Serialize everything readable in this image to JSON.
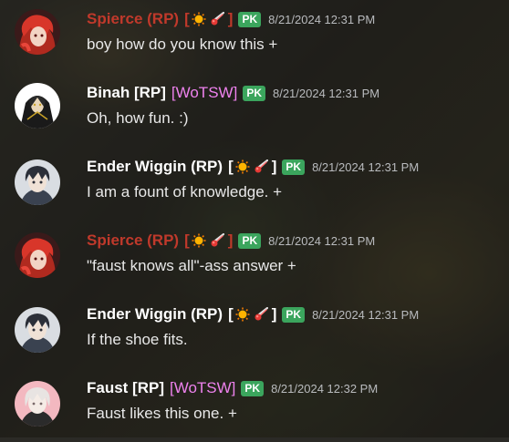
{
  "colors": {
    "spierce_name": "#c0392b",
    "white_name": "#ffffff",
    "wotsw_tag": "#ee82ee",
    "pk_badge": "#3ba55d",
    "timestamp": "#b9bbbe",
    "message_text": "#e8e8e8"
  },
  "messages": [
    {
      "author": "Spierce (RP)",
      "decoration_open": "[",
      "decoration_close": "]",
      "decoration_icons": [
        "sun-icon",
        "meteor-icon"
      ],
      "badge": "PK",
      "timestamp": "8/21/2024 12:31 PM",
      "text": "boy how do you know this +"
    },
    {
      "author": "Binah [RP]",
      "tag": "[WoTSW]",
      "badge": "PK",
      "timestamp": "8/21/2024 12:31 PM",
      "text": "Oh, how fun. :)"
    },
    {
      "author": "Ender Wiggin (RP)",
      "decoration_open": "[",
      "decoration_close": "]",
      "decoration_icons": [
        "sun-icon",
        "meteor-icon"
      ],
      "badge": "PK",
      "timestamp": "8/21/2024 12:31 PM",
      "text": "I am a fount of knowledge. +"
    },
    {
      "author": "Spierce (RP)",
      "decoration_open": "[",
      "decoration_close": "]",
      "decoration_icons": [
        "sun-icon",
        "meteor-icon"
      ],
      "badge": "PK",
      "timestamp": "8/21/2024 12:31 PM",
      "text": "\"faust knows all\"-ass answer +"
    },
    {
      "author": "Ender Wiggin (RP)",
      "decoration_open": "[",
      "decoration_close": "]",
      "decoration_icons": [
        "sun-icon",
        "meteor-icon"
      ],
      "badge": "PK",
      "timestamp": "8/21/2024 12:31 PM",
      "text": "If the shoe fits."
    },
    {
      "author": "Faust [RP]",
      "tag": "[WoTSW]",
      "badge": "PK",
      "timestamp": "8/21/2024 12:32 PM",
      "text": "Faust likes this one. +"
    }
  ]
}
